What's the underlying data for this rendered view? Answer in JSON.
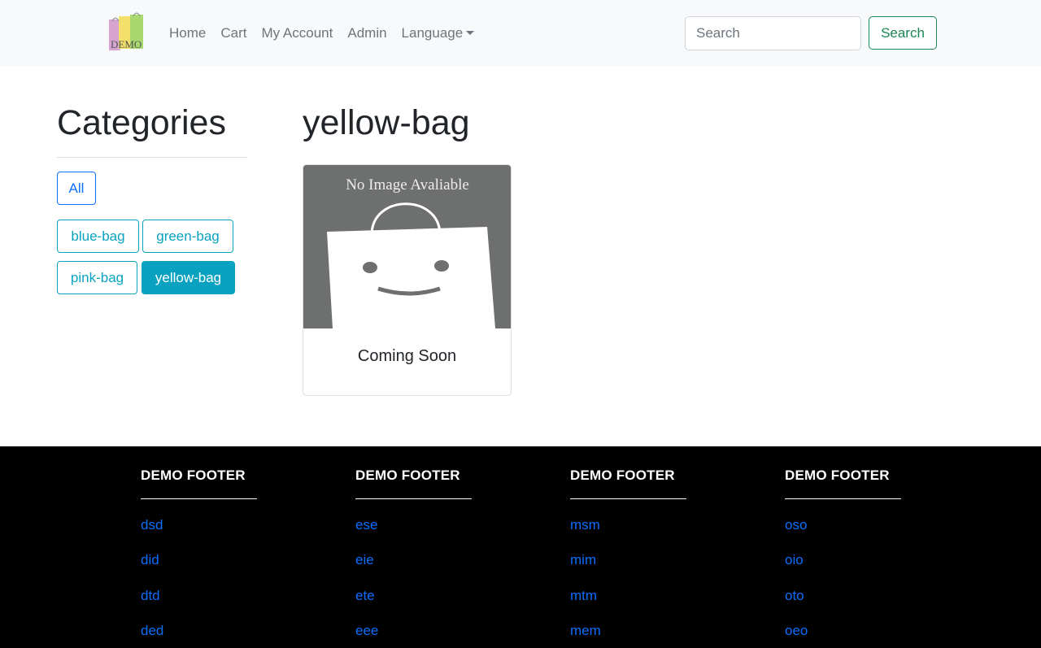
{
  "navbar": {
    "logo_text": "DEMO",
    "links": [
      {
        "label": "Home"
      },
      {
        "label": "Cart"
      },
      {
        "label": "My Account"
      },
      {
        "label": "Admin"
      },
      {
        "label": "Language"
      }
    ],
    "search_placeholder": "Search",
    "search_button": "Search"
  },
  "sidebar": {
    "title": "Categories",
    "all_label": "All",
    "categories": [
      "blue-bag",
      "green-bag",
      "pink-bag",
      "yellow-bag"
    ],
    "active_category": "yellow-bag"
  },
  "main": {
    "title": "yellow-bag",
    "product": {
      "image_text": "No Image Avaliable",
      "name": "Coming Soon"
    }
  },
  "footer": {
    "columns": [
      {
        "heading": "DEMO FOOTER",
        "links": [
          "dsd",
          "did",
          "dtd",
          "ded"
        ]
      },
      {
        "heading": "DEMO FOOTER",
        "links": [
          "ese",
          "eie",
          "ete",
          "eee"
        ]
      },
      {
        "heading": "DEMO FOOTER",
        "links": [
          "msm",
          "mim",
          "mtm",
          "mem"
        ]
      },
      {
        "heading": "DEMO FOOTER",
        "links": [
          "oso",
          "oio",
          "oto",
          "oeo"
        ]
      }
    ]
  },
  "colors": {
    "navbar_bg": "#f8f9fa",
    "primary": "#0d6efd",
    "info": "#0aa2c0",
    "success": "#198754",
    "footer_bg": "#000000"
  }
}
